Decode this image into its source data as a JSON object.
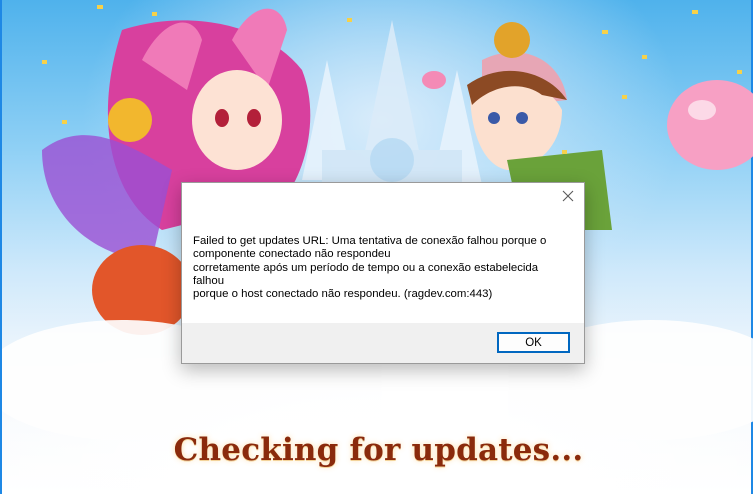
{
  "launcher": {
    "status_text": "Checking for updates..."
  },
  "dialog": {
    "close_icon": "close-icon",
    "message": "Failed to get updates URL: Uma tentativa de conexão falhou porque o\ncomponente conectado não respondeu\ncorretamente após um período de tempo ou a conexão estabelecida\nfalhou\nporque o host conectado não respondeu. (ragdev.com:443)",
    "ok_label": "OK"
  },
  "colors": {
    "status_text": "#8a2a0c",
    "button_accent": "#0067c0",
    "footer_bg": "#f0f0f0",
    "window_border": "#1e88e5"
  }
}
